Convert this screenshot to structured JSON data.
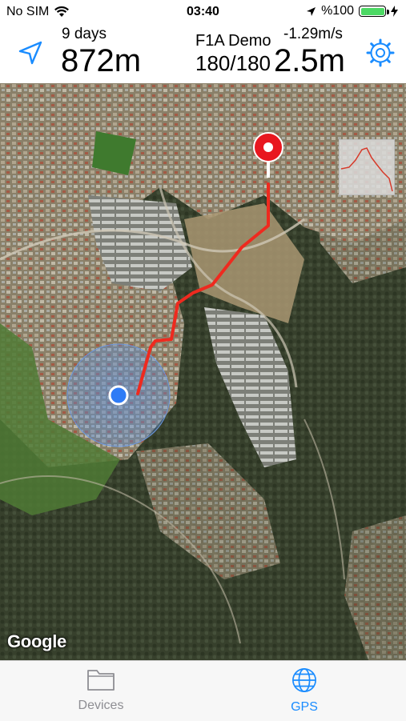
{
  "status_bar": {
    "carrier": "No SIM",
    "time": "03:40",
    "battery_percent": "%100",
    "battery_level": 1.0,
    "icons": [
      "wifi-icon",
      "location-arrow-icon",
      "charging-bolt-icon"
    ]
  },
  "header": {
    "elapsed": "9 days",
    "distance": "872m",
    "device_name": "F1A Demo",
    "count": "180/180",
    "vertical_speed": "-1.29m/s",
    "altitude": "2.5m",
    "accent_color": "#1a8cff"
  },
  "map": {
    "attribution": "Google",
    "track_color": "#ee2a1f",
    "pin_color": "#e8171f",
    "user_location_color": "#2f7cf6"
  },
  "tab_bar": {
    "tabs": [
      {
        "label": "Devices",
        "icon": "folder-icon",
        "selected": false
      },
      {
        "label": "GPS",
        "icon": "globe-icon",
        "selected": true
      }
    ]
  }
}
